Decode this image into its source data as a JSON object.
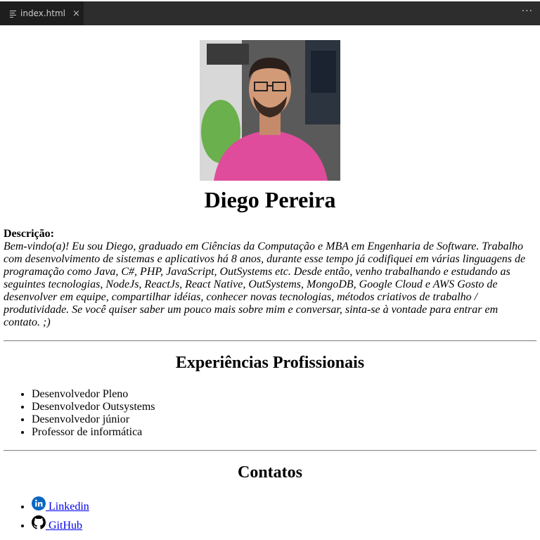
{
  "editor": {
    "tab_label": "index.html",
    "close_glyph": "×",
    "more_glyph": "···"
  },
  "profile": {
    "name": "Diego Pereira",
    "photo_alt": "Diego Pereira"
  },
  "about": {
    "title": "Descrição:",
    "text": "Bem-vindo(a)! Eu sou Diego, graduado em Ciências da Computação e MBA em Engenharia de Software. Trabalho com desenvolvimento de sistemas e aplicativos há 8 anos, durante esse tempo já codifiquei em várias linguagens de programação como Java, C#, PHP, JavaScript, OutSystems etc. Desde então, venho trabalhando e estudando as seguintes tecnologias, NodeJs, ReactJs, React Native, OutSystems, MongoDB, Google Cloud e AWS Gosto de desenvolver em equipe, compartilhar idéias, conhecer novas tecnologias, métodos criativos de trabalho / produtividade. Se você quiser saber um pouco mais sobre mim e conversar, sinta-se à vontade para entrar em contato. ;)"
  },
  "experience": {
    "title": "Experiências Profissionais",
    "items": [
      "Desenvolvedor Pleno",
      "Desenvolvedor Outsystems",
      "Desenvolvedor júnior",
      "Professor de informática"
    ]
  },
  "contacts": {
    "title": "Contatos",
    "linkedin_label": "Linkedin",
    "github_label": "GitHub"
  },
  "colors": {
    "tabbar_bg": "#2d2d2d",
    "tab_active_bg": "#1e1e1e",
    "link": "#0000ee",
    "linkedin_blue": "#0a66c2"
  },
  "icons": [
    "file-lines-icon",
    "close-icon",
    "more-icon",
    "linkedin-icon",
    "github-icon"
  ]
}
